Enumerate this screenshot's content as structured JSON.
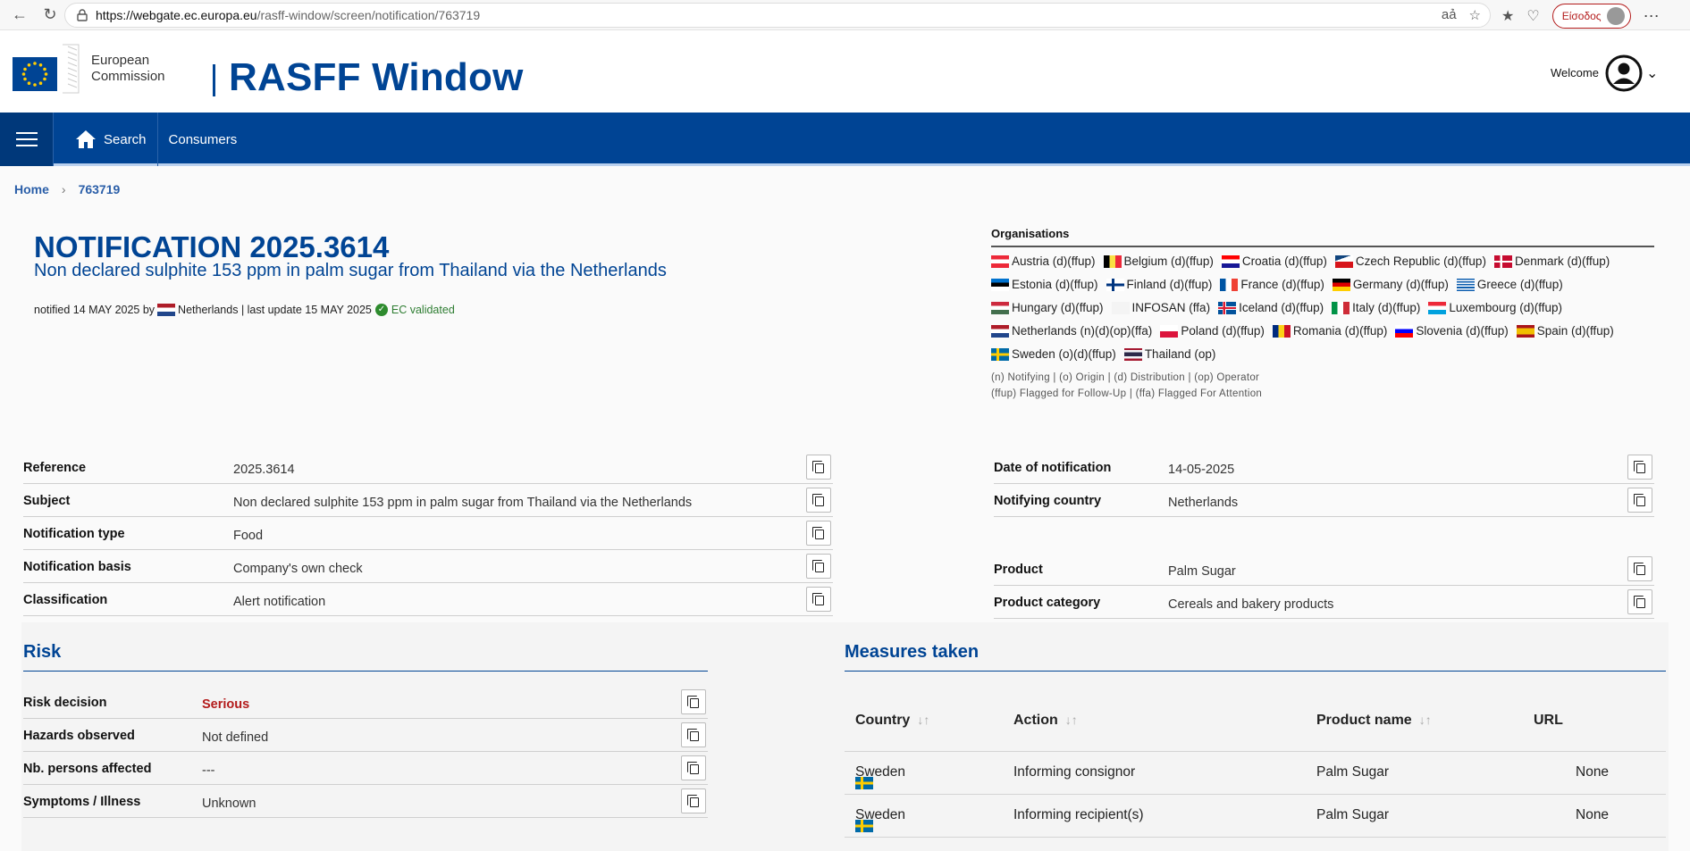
{
  "browser": {
    "url_host": "https://webgate.ec.europa.eu",
    "url_path": "/rasff-window/screen/notification/763719",
    "signin_label": "Είσοδος"
  },
  "header": {
    "org_line1": "European",
    "org_line2": "Commission",
    "app_title": "RASFF Window",
    "welcome": "Welcome"
  },
  "nav": {
    "search": "Search",
    "consumers": "Consumers"
  },
  "breadcrumb": {
    "home": "Home",
    "current": "763719"
  },
  "notification": {
    "title": "NOTIFICATION 2025.3614",
    "subtitle": "Non declared sulphite 153 ppm in palm sugar from Thailand via the Netherlands",
    "meta_prefix": "notified 14 MAY 2025 by",
    "meta_country": "Netherlands",
    "meta_update": "| last update 15 MAY 2025",
    "validated": "EC validated"
  },
  "organisations": {
    "title": "Organisations",
    "items": [
      {
        "label": "Austria (d)(ffup)",
        "flag": "at"
      },
      {
        "label": "Belgium (d)(ffup)",
        "flag": "be"
      },
      {
        "label": "Croatia (d)(ffup)",
        "flag": "hr"
      },
      {
        "label": "Czech Republic (d)(ffup)",
        "flag": "cz"
      },
      {
        "label": "Denmark (d)(ffup)",
        "flag": "dk"
      },
      {
        "label": "Estonia (d)(ffup)",
        "flag": "ee"
      },
      {
        "label": "Finland (d)(ffup)",
        "flag": "fi"
      },
      {
        "label": "France (d)(ffup)",
        "flag": "fr"
      },
      {
        "label": "Germany (d)(ffup)",
        "flag": "de"
      },
      {
        "label": "Greece (d)(ffup)",
        "flag": "gr"
      },
      {
        "label": "Hungary (d)(ffup)",
        "flag": "hu"
      },
      {
        "label": "INFOSAN (ffa)",
        "flag": "none"
      },
      {
        "label": "Iceland (d)(ffup)",
        "flag": "is"
      },
      {
        "label": "Italy (d)(ffup)",
        "flag": "it"
      },
      {
        "label": "Luxembourg (d)(ffup)",
        "flag": "lu"
      },
      {
        "label": "Netherlands (n)(d)(op)(ffa)",
        "flag": "nl"
      },
      {
        "label": "Poland (d)(ffup)",
        "flag": "pl"
      },
      {
        "label": "Romania (d)(ffup)",
        "flag": "ro"
      },
      {
        "label": "Slovenia (d)(ffup)",
        "flag": "si"
      },
      {
        "label": "Spain (d)(ffup)",
        "flag": "es"
      },
      {
        "label": "Sweden (o)(d)(ffup)",
        "flag": "se"
      },
      {
        "label": "Thailand (op)",
        "flag": "th"
      }
    ],
    "legend1": "(n) Notifying | (o) Origin | (d) Distribution | (op) Operator",
    "legend2": "(ffup) Flagged for Follow-Up | (ffa) Flagged For Attention"
  },
  "details_left": [
    {
      "label": "Reference",
      "value": "2025.3614"
    },
    {
      "label": "Subject",
      "value": "Non declared sulphite 153 ppm in palm sugar from Thailand via the Netherlands"
    },
    {
      "label": "Notification type",
      "value": "Food"
    },
    {
      "label": "Notification basis",
      "value": "Company's own check"
    },
    {
      "label": "Classification",
      "value": "Alert notification"
    }
  ],
  "details_right": [
    {
      "label": "Date of notification",
      "value": "14-05-2025"
    },
    {
      "label": "Notifying country",
      "value": "Netherlands"
    },
    {
      "label": "Product",
      "value": "Palm Sugar"
    },
    {
      "label": "Product category",
      "value": "Cereals and bakery products"
    }
  ],
  "risk": {
    "title": "Risk",
    "rows": [
      {
        "label": "Risk decision",
        "value": "Serious"
      },
      {
        "label": "Hazards observed",
        "value": "Not defined"
      },
      {
        "label": "Nb. persons affected",
        "value": "---"
      },
      {
        "label": "Symptoms / Illness",
        "value": "Unknown"
      }
    ]
  },
  "measures": {
    "title": "Measures taken",
    "columns": [
      "Country",
      "Action",
      "Product name",
      "URL"
    ],
    "rows": [
      {
        "country": "Sweden",
        "action": "Informing consignor",
        "product": "Palm Sugar",
        "url": "None"
      },
      {
        "country": "Sweden",
        "action": "Informing recipient(s)",
        "product": "Palm Sugar",
        "url": "None"
      }
    ]
  },
  "colors": {
    "brand_blue": "#004494",
    "serious_red": "#b31b1b",
    "validated_green": "#2e7d32"
  }
}
